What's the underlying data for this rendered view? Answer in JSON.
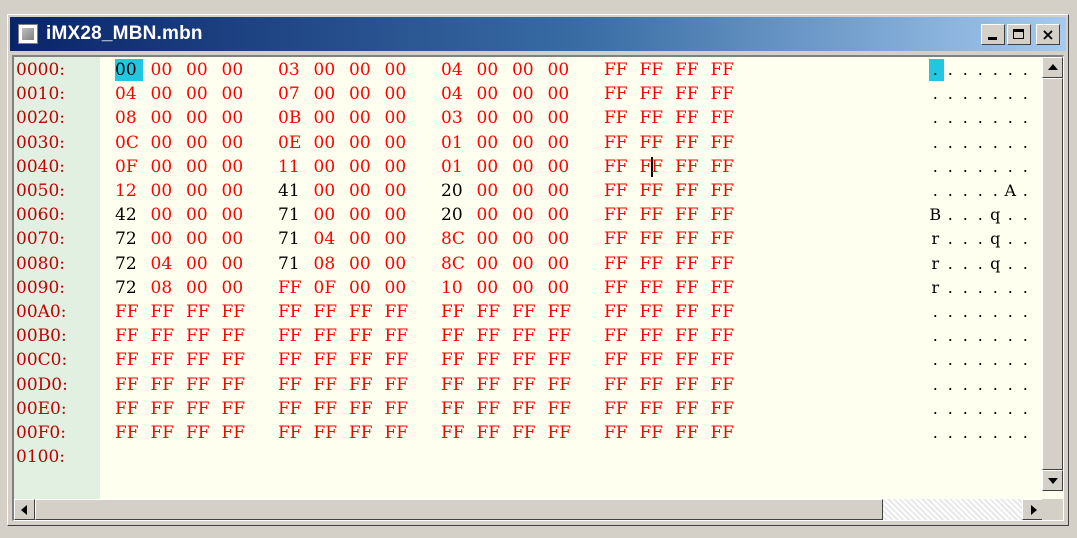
{
  "window": {
    "title": "iMX28_MBN.mbn",
    "icon": "document-icon",
    "buttons": {
      "minimize": "_",
      "maximize": "□",
      "close": "×"
    }
  },
  "colors": {
    "title_gradient_start": "#0a246a",
    "title_gradient_end": "#a6caf0",
    "byte_red": "#ff0000",
    "byte_black": "#000000",
    "address_gutter": "#e1f0e1",
    "content_bg": "#fffff0",
    "selection": "#22c6e0"
  },
  "hexdump": {
    "rows": [
      {
        "addr": "0000:",
        "bytes": [
          "00",
          "00",
          "00",
          "00",
          "03",
          "00",
          "00",
          "00",
          "04",
          "00",
          "00",
          "00",
          "FF",
          "FF",
          "FF",
          "FF"
        ],
        "ascii": ". . . . . . . ."
      },
      {
        "addr": "0010:",
        "bytes": [
          "04",
          "00",
          "00",
          "00",
          "07",
          "00",
          "00",
          "00",
          "04",
          "00",
          "00",
          "00",
          "FF",
          "FF",
          "FF",
          "FF"
        ],
        "ascii": ". . . . . . . ."
      },
      {
        "addr": "0020:",
        "bytes": [
          "08",
          "00",
          "00",
          "00",
          "0B",
          "00",
          "00",
          "00",
          "03",
          "00",
          "00",
          "00",
          "FF",
          "FF",
          "FF",
          "FF"
        ],
        "ascii": ". . . . . . . ."
      },
      {
        "addr": "0030:",
        "bytes": [
          "0C",
          "00",
          "00",
          "00",
          "0E",
          "00",
          "00",
          "00",
          "01",
          "00",
          "00",
          "00",
          "FF",
          "FF",
          "FF",
          "FF"
        ],
        "ascii": ". . . . . . . ."
      },
      {
        "addr": "0040:",
        "bytes": [
          "0F",
          "00",
          "00",
          "00",
          "11",
          "00",
          "00",
          "00",
          "01",
          "00",
          "00",
          "00",
          "FF",
          "FF",
          "FF",
          "FF"
        ],
        "ascii": ". . . . . . . ."
      },
      {
        "addr": "0050:",
        "bytes": [
          "12",
          "00",
          "00",
          "00",
          "41",
          "00",
          "00",
          "00",
          "20",
          "00",
          "00",
          "00",
          "FF",
          "FF",
          "FF",
          "FF"
        ],
        "ascii": ". . . . . A . ."
      },
      {
        "addr": "0060:",
        "bytes": [
          "42",
          "00",
          "00",
          "00",
          "71",
          "00",
          "00",
          "00",
          "20",
          "00",
          "00",
          "00",
          "FF",
          "FF",
          "FF",
          "FF"
        ],
        "ascii": "B . . . q . . ."
      },
      {
        "addr": "0070:",
        "bytes": [
          "72",
          "00",
          "00",
          "00",
          "71",
          "04",
          "00",
          "00",
          "8C",
          "00",
          "00",
          "00",
          "FF",
          "FF",
          "FF",
          "FF"
        ],
        "ascii": "r . . . q . . ."
      },
      {
        "addr": "0080:",
        "bytes": [
          "72",
          "04",
          "00",
          "00",
          "71",
          "08",
          "00",
          "00",
          "8C",
          "00",
          "00",
          "00",
          "FF",
          "FF",
          "FF",
          "FF"
        ],
        "ascii": "r . . . q . . ."
      },
      {
        "addr": "0090:",
        "bytes": [
          "72",
          "08",
          "00",
          "00",
          "FF",
          "0F",
          "00",
          "00",
          "10",
          "00",
          "00",
          "00",
          "FF",
          "FF",
          "FF",
          "FF"
        ],
        "ascii": "r . . . . . . ."
      },
      {
        "addr": "00A0:",
        "bytes": [
          "FF",
          "FF",
          "FF",
          "FF",
          "FF",
          "FF",
          "FF",
          "FF",
          "FF",
          "FF",
          "FF",
          "FF",
          "FF",
          "FF",
          "FF",
          "FF"
        ],
        "ascii": ". . . . . . . ."
      },
      {
        "addr": "00B0:",
        "bytes": [
          "FF",
          "FF",
          "FF",
          "FF",
          "FF",
          "FF",
          "FF",
          "FF",
          "FF",
          "FF",
          "FF",
          "FF",
          "FF",
          "FF",
          "FF",
          "FF"
        ],
        "ascii": ". . . . . . . ."
      },
      {
        "addr": "00C0:",
        "bytes": [
          "FF",
          "FF",
          "FF",
          "FF",
          "FF",
          "FF",
          "FF",
          "FF",
          "FF",
          "FF",
          "FF",
          "FF",
          "FF",
          "FF",
          "FF",
          "FF"
        ],
        "ascii": ". . . . . . . ."
      },
      {
        "addr": "00D0:",
        "bytes": [
          "FF",
          "FF",
          "FF",
          "FF",
          "FF",
          "FF",
          "FF",
          "FF",
          "FF",
          "FF",
          "FF",
          "FF",
          "FF",
          "FF",
          "FF",
          "FF"
        ],
        "ascii": ". . . . . . . ."
      },
      {
        "addr": "00E0:",
        "bytes": [
          "FF",
          "FF",
          "FF",
          "FF",
          "FF",
          "FF",
          "FF",
          "FF",
          "FF",
          "FF",
          "FF",
          "FF",
          "FF",
          "FF",
          "FF",
          "FF"
        ],
        "ascii": ". . . . . . . ."
      },
      {
        "addr": "00F0:",
        "bytes": [
          "FF",
          "FF",
          "FF",
          "FF",
          "FF",
          "FF",
          "FF",
          "FF",
          "FF",
          "FF",
          "FF",
          "FF",
          "FF",
          "FF",
          "FF",
          "FF"
        ],
        "ascii": ". . . . . . . ."
      },
      {
        "addr": "0100:",
        "bytes": [],
        "ascii": ""
      }
    ],
    "black_bytes": [
      [
        5,
        4
      ],
      [
        5,
        8
      ],
      [
        6,
        0
      ],
      [
        6,
        4
      ],
      [
        6,
        8
      ],
      [
        7,
        0
      ],
      [
        7,
        4
      ],
      [
        8,
        0
      ],
      [
        8,
        4
      ],
      [
        9,
        0
      ]
    ],
    "selected_byte": [
      0,
      0
    ],
    "caret_after_byte": [
      4,
      12
    ]
  },
  "scrollbars": {
    "vertical": {
      "up": "up-arrow",
      "down": "down-arrow"
    },
    "horizontal": {
      "left": "left-arrow",
      "right": "right-arrow"
    }
  }
}
